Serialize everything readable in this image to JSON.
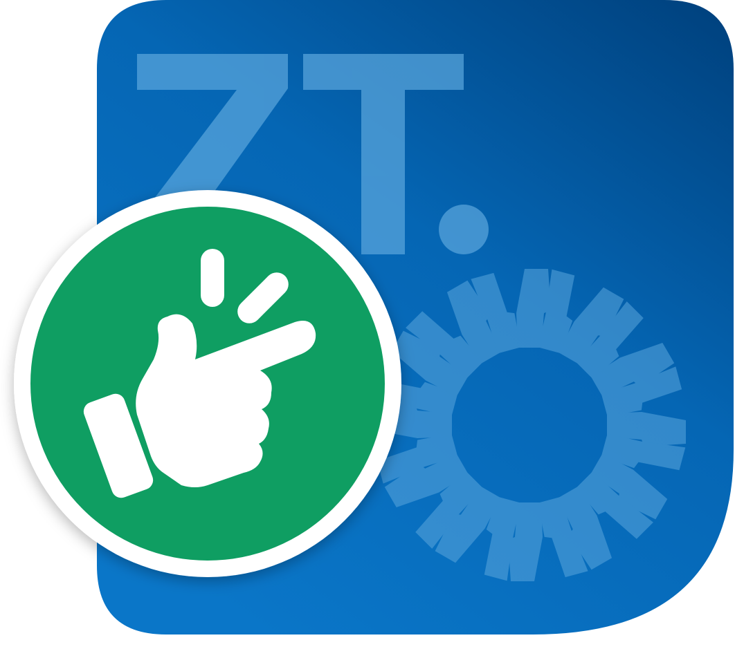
{
  "app_icon": {
    "logo_text": "ZT.",
    "badge_icon": "finger-snap-icon",
    "tile_icon": "sunburst-icon",
    "colors": {
      "tile_light": "#0a78c8",
      "tile_dark": "#004480",
      "badge_green": "#0f9e62",
      "badge_ring": "#ffffff",
      "glyph": "#ffffff",
      "watermark": "#5aa6dd"
    }
  }
}
